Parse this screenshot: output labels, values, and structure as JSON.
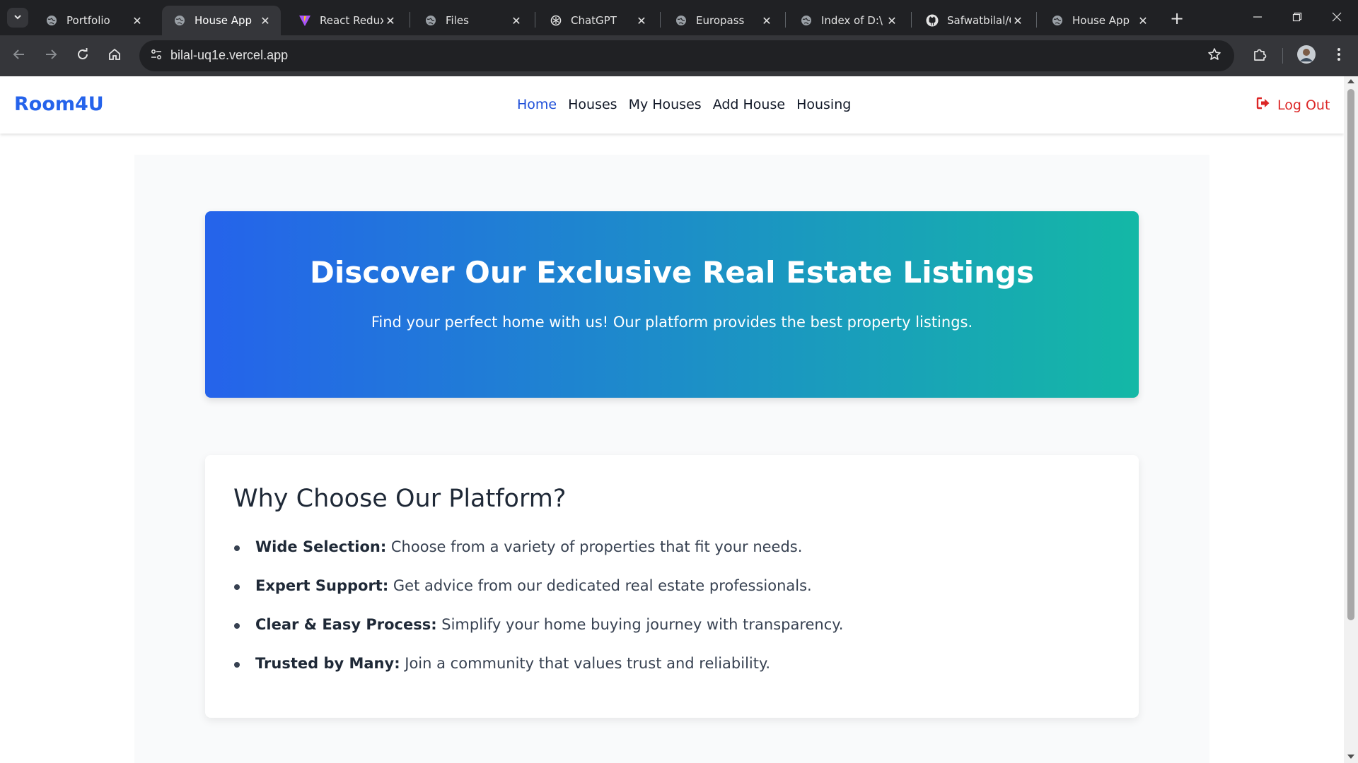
{
  "browser": {
    "tabs": [
      {
        "title": "Portfolio",
        "icon": "globe-icon",
        "active": false
      },
      {
        "title": "House App",
        "icon": "globe-icon",
        "active": true
      },
      {
        "title": "React Redux",
        "icon": "vite-icon",
        "active": false
      },
      {
        "title": "Files",
        "icon": "globe-icon",
        "active": false
      },
      {
        "title": "ChatGPT",
        "icon": "chatgpt-icon",
        "active": false
      },
      {
        "title": "Europass",
        "icon": "globe-icon",
        "active": false
      },
      {
        "title": "Index of D:\\",
        "icon": "globe-icon",
        "active": false
      },
      {
        "title": "Safwatbilal/G",
        "icon": "github-icon",
        "active": false
      },
      {
        "title": "House App",
        "icon": "globe-icon",
        "active": false
      }
    ],
    "url": "bilal-uq1e.vercel.app"
  },
  "navbar": {
    "brand": "Room4U",
    "links": [
      {
        "label": "Home",
        "current": true
      },
      {
        "label": "Houses",
        "current": false
      },
      {
        "label": "My Houses",
        "current": false
      },
      {
        "label": "Add House",
        "current": false
      },
      {
        "label": "Housing",
        "current": false
      }
    ],
    "logout_label": "Log Out"
  },
  "hero": {
    "title": "Discover Our Exclusive Real Estate Listings",
    "subtitle": "Find your perfect home with us! Our platform provides the best property listings."
  },
  "why": {
    "heading": "Why Choose Our Platform?",
    "items": [
      {
        "label": "Wide Selection:",
        "text": " Choose from a variety of properties that fit your needs."
      },
      {
        "label": "Expert Support:",
        "text": " Get advice from our dedicated real estate professionals."
      },
      {
        "label": "Clear & Easy Process:",
        "text": " Simplify your home buying journey with transparency."
      },
      {
        "label": "Trusted by Many:",
        "text": " Join a community that values trust and reliability."
      }
    ]
  },
  "colors": {
    "brand": "#2563eb",
    "logout": "#dc2626",
    "hero_gradient_start": "#2563eb",
    "hero_gradient_end": "#14b8a6"
  }
}
